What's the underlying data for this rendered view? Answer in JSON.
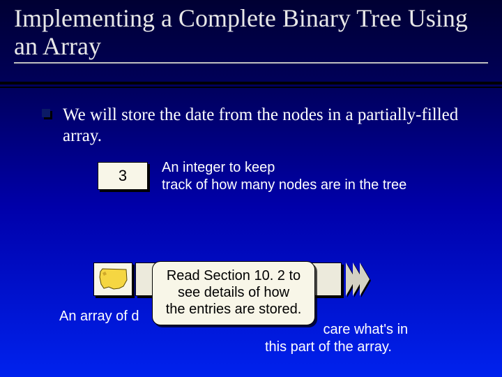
{
  "title": "Implementing a Complete Binary Tree Using an Array",
  "bullet": "We will store the date from the nodes in a partially-filled array.",
  "int_value": "3",
  "int_caption_l1": "An integer to keep",
  "int_caption_l2": "track of how many nodes are in the tree",
  "array_caption": "An array of d",
  "note_l1": "Read Section 10. 2 to",
  "note_l2": "see details of how",
  "note_l3": "the entries are stored.",
  "tail_caption_l1": "care what's in",
  "tail_caption_l2": "this part of the array.",
  "icons": {
    "bullet": "shadow-square-icon",
    "wa_state": "washington-state-icon"
  },
  "colors": {
    "bg_top": "#000033",
    "bg_bottom": "#0022ee",
    "panel": "#f8f6e8",
    "wa_fill": "#f5d642"
  }
}
